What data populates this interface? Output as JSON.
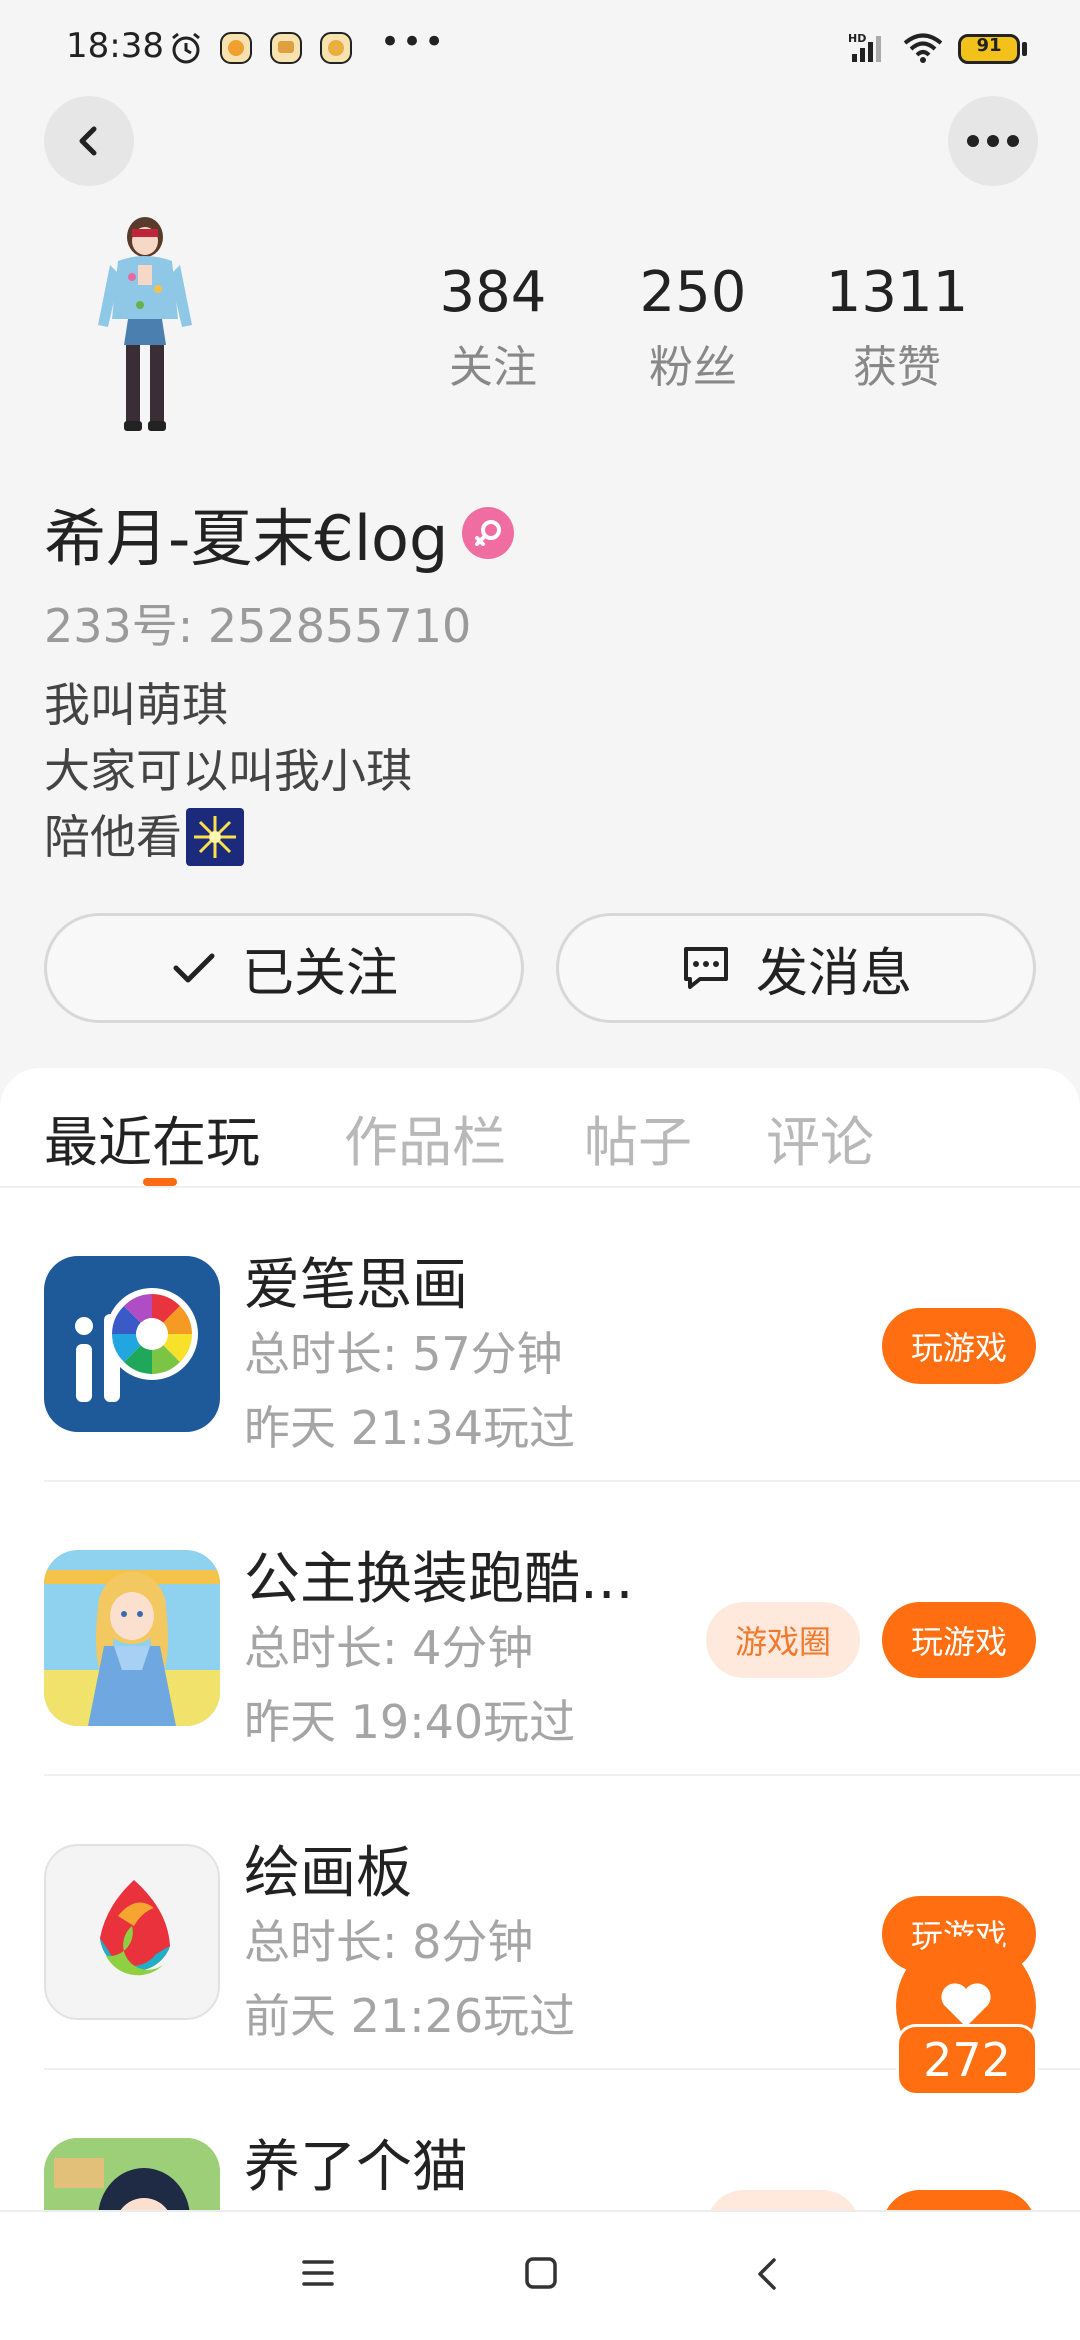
{
  "status_bar": {
    "time": "18:38",
    "more": "•••",
    "battery": "91",
    "icons": [
      "alarm-icon",
      "app-notification-icon",
      "app-notification-icon",
      "app-notification-icon",
      "hd-signal-icon",
      "wifi-icon",
      "battery-icon"
    ]
  },
  "header": {
    "back_icon": "chevron-left-icon",
    "more_icon": "more-horizontal-icon"
  },
  "profile": {
    "stats": [
      {
        "value": "384",
        "label": "关注"
      },
      {
        "value": "250",
        "label": "粉丝"
      },
      {
        "value": "1311",
        "label": "获赞"
      }
    ],
    "username": "希月-夏末€log",
    "gender_icon": "female-icon",
    "user_id": "233号: 252855710",
    "bio": [
      "我叫萌琪",
      "大家可以叫我小琪",
      "陪他看"
    ],
    "bio_emoji": "sparkler-emoji-icon"
  },
  "actions": {
    "follow_label": "已关注",
    "message_label": "发消息"
  },
  "tabs": [
    "最近在玩",
    "作品栏",
    "帖子",
    "评论"
  ],
  "games": [
    {
      "title": "爱笔思画",
      "duration": "总时长: 57分钟",
      "last_played": "昨天 21:34玩过",
      "play_label": "玩游戏"
    },
    {
      "title": "公主换装跑酷...",
      "duration": "总时长: 4分钟",
      "last_played": "昨天 19:40玩过",
      "circle_label": "游戏圈",
      "play_label": "玩游戏"
    },
    {
      "title": "绘画板",
      "duration": "总时长: 8分钟",
      "last_played": "前天 21:26玩过",
      "play_label": "玩游戏"
    },
    {
      "title": "养了个猫",
      "duration": "",
      "last_played": "",
      "circle_label": "",
      "play_label": ""
    }
  ],
  "floating_like": {
    "count": "272",
    "icon": "heart-icon"
  },
  "colors": {
    "accent": "#ff6f12",
    "accent_light": "#ffe8dc",
    "female_badge": "#f06da2"
  }
}
